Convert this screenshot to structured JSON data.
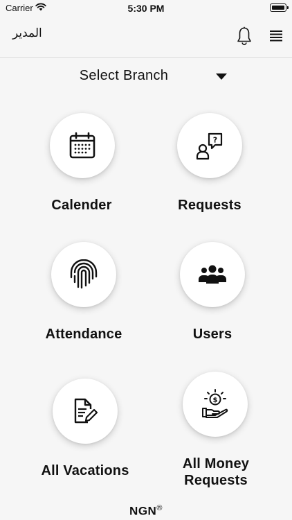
{
  "status_bar": {
    "carrier": "Carrier",
    "time": "5:30 PM",
    "battery_level": 1.0
  },
  "header": {
    "title": "المدير",
    "notification_icon": "bell-icon",
    "menu_icon": "menu-icon"
  },
  "branch_selector": {
    "label": "Select Branch",
    "icon": "caret-down-icon"
  },
  "tiles": [
    {
      "label": "Calender",
      "icon": "calendar-icon"
    },
    {
      "label": "Requests",
      "icon": "question-chat-icon"
    },
    {
      "label": "Attendance",
      "icon": "fingerprint-icon"
    },
    {
      "label": "Users",
      "icon": "users-icon"
    },
    {
      "label": "All Vacations",
      "icon": "document-edit-icon"
    },
    {
      "label": "All Money Requests",
      "icon": "money-hand-icon"
    }
  ],
  "footer": {
    "brand": "NGN",
    "trademark": "®"
  },
  "colors": {
    "background": "#f6f6f6",
    "text": "#111111",
    "tile_background": "#ffffff"
  }
}
